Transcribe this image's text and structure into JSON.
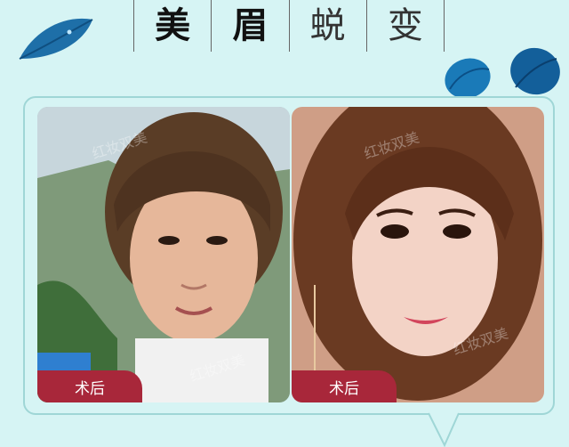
{
  "header": {
    "title_chars": [
      "美",
      "眉",
      "蜕",
      "变"
    ]
  },
  "photos": {
    "before": {
      "tag": "术后",
      "watermark": "红妆双美"
    },
    "after": {
      "tag": "术后",
      "watermark": "红妆双美"
    }
  }
}
